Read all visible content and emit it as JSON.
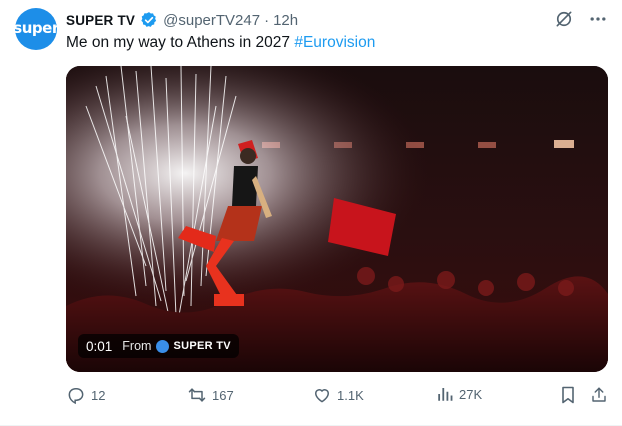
{
  "account": {
    "avatar_text": "super",
    "name": "SUPER TV",
    "handle": "@superTV247",
    "separator": "·",
    "time": "12h"
  },
  "post": {
    "text": "Me on my way to Athens in 2027",
    "hashtag": "#Eurovision"
  },
  "video": {
    "timestamp": "0:01",
    "from_label": "From",
    "source_name": "SUPER TV"
  },
  "actions": {
    "replies": "12",
    "reposts": "167",
    "likes": "1.1K",
    "views": "27K"
  },
  "colors": {
    "accent": "#1d9bf0",
    "muted": "#536471",
    "avatar_bg": "#1d8ee8"
  },
  "icons": [
    "verified-badge-icon",
    "grok-icon",
    "more-icon",
    "reply-icon",
    "repost-icon",
    "like-icon",
    "views-icon",
    "bookmark-icon",
    "share-icon"
  ]
}
